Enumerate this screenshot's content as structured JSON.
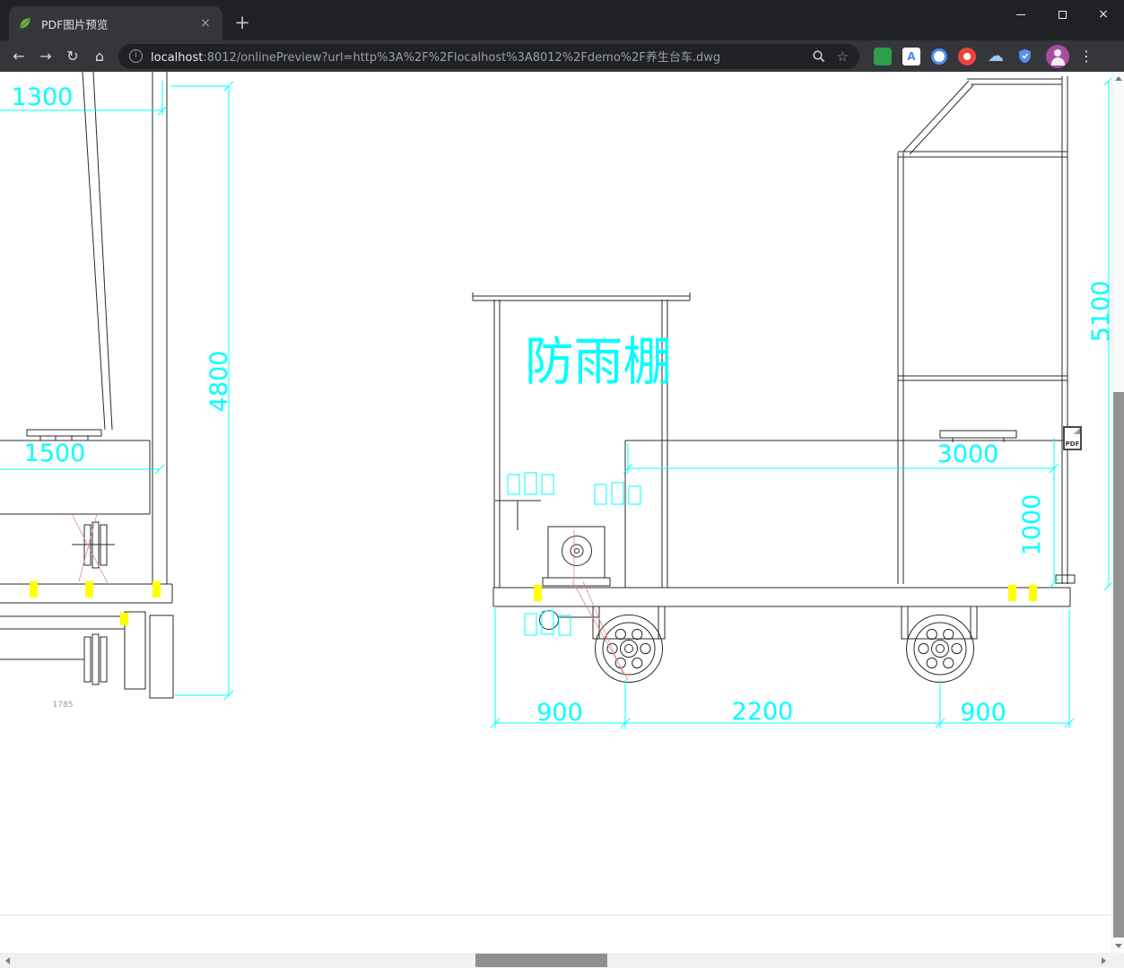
{
  "tab": {
    "title": "PDF图片预览"
  },
  "window_controls": {
    "close": "×"
  },
  "icons": {
    "back": "←",
    "forward": "→",
    "reload": "↻",
    "home": "⌂",
    "info": "i",
    "star": "☆",
    "menu": "⋮",
    "tab_close": "×",
    "new_tab": "+",
    "cloud": "☁",
    "translate": "A"
  },
  "omnibox": {
    "host": "localhost",
    "path": ":8012/onlinePreview?url=http%3A%2F%2Flocalhost%3A8012%2Fdemo%2F养生台车.dwg"
  },
  "drawing": {
    "canopy_label": "防雨棚",
    "pdf_badge": "PDF",
    "dims": {
      "d1300": "1300",
      "d4800": "4800",
      "d1500": "1500",
      "d5100": "5100",
      "d3000": "3000",
      "d1000": "1000",
      "d900_left": "900",
      "d2200": "2200",
      "d900_right": "900",
      "d_small": "1785"
    },
    "colors": {
      "dimension": "#00ffff",
      "highlight": "#ffff00",
      "geometry": "#2a2a2a"
    }
  }
}
